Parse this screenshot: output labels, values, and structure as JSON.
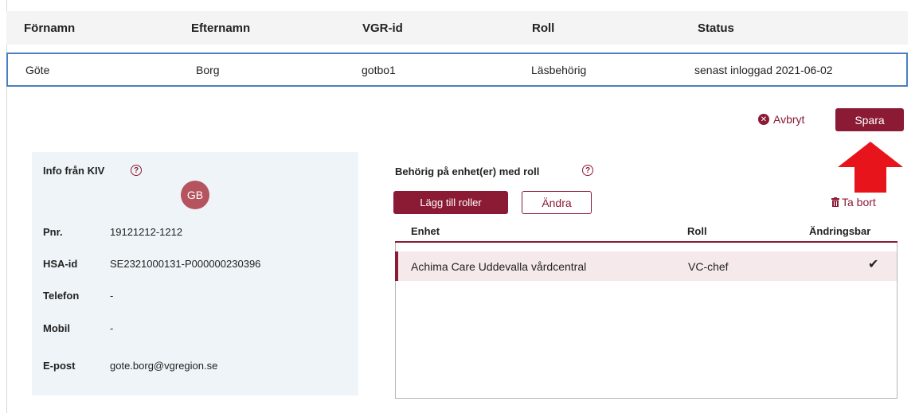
{
  "table": {
    "headers": [
      "Förnamn",
      "Efternamn",
      "VGR-id",
      "Roll",
      "Status"
    ],
    "selected_row": [
      "Göte",
      "Borg",
      "gotbo1",
      "Läsbehörig",
      "senast inloggad 2021-06-02"
    ]
  },
  "actions": {
    "cancel_label": "Avbryt",
    "save_label": "Spara"
  },
  "info": {
    "title": "Info från KIV",
    "initials": "GB",
    "fields": [
      {
        "label": "Pnr.",
        "value": "19121212-1212"
      },
      {
        "label": "HSA-id",
        "value": "SE2321000131-P000000230396"
      },
      {
        "label": "Telefon",
        "value": "-"
      },
      {
        "label": "Mobil",
        "value": "-"
      },
      {
        "label": "E-post",
        "value": "gote.borg@vgregion.se"
      }
    ]
  },
  "roles": {
    "title": "Behörig på enhet(er) med roll",
    "add_label": "Lägg till roller",
    "edit_label": "Ändra",
    "delete_label": "Ta bort",
    "headers": [
      "Enhet",
      "Roll",
      "Ändringsbar"
    ],
    "rows": [
      {
        "enhet": "Achima Care Uddevalla vårdcentral",
        "roll": "VC-chef",
        "andringsbar": "✔"
      }
    ]
  },
  "icons": {
    "help": "?",
    "cancel": "✕"
  },
  "colors": {
    "accent": "#8b1a35",
    "selection_border": "#4a7fc1",
    "info_bg": "#eef4f8",
    "arrow": "#e8141c"
  }
}
